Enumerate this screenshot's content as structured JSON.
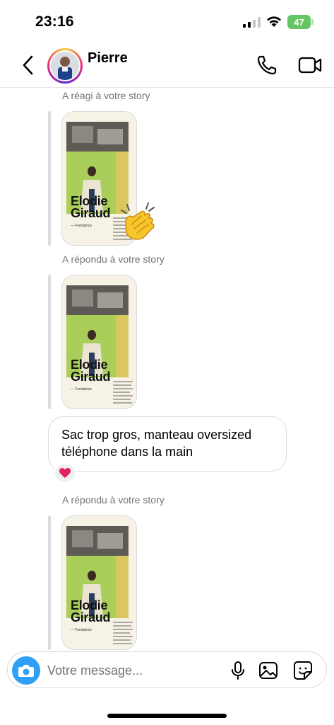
{
  "status_bar": {
    "time": "23:16",
    "battery": "47"
  },
  "header": {
    "contact_name": "Pierre"
  },
  "messages": [
    {
      "type": "story",
      "meta": "A réagi à votre story",
      "story_title_line1": "Elodie",
      "story_title_line2": "Giraud",
      "story_subtitle": "— Fondatrice",
      "reaction_emoji": "👏"
    },
    {
      "type": "story",
      "meta": "A répondu à votre story",
      "story_title_line1": "Elodie",
      "story_title_line2": "Giraud",
      "story_subtitle": "— Fondatrice"
    },
    {
      "type": "text",
      "text_line1": "Sac trop gros, manteau oversized",
      "text_line2": "téléphone dans la main",
      "reaction": "❤️"
    },
    {
      "type": "story",
      "meta": "A répondu à votre story",
      "story_title_line1": "Elodie",
      "story_title_line2": "Giraud",
      "story_subtitle": "— Fondatrice"
    }
  ],
  "composer": {
    "placeholder": "Votre message..."
  },
  "colors": {
    "accent_blue": "#2fa0f5",
    "battery_green": "#65c466",
    "meta_gray": "#737373",
    "border": "#dbdbdb"
  },
  "icons": [
    "back-chevron-icon",
    "phone-icon",
    "video-camera-icon",
    "camera-icon",
    "microphone-icon",
    "gallery-icon",
    "sticker-icon",
    "heart-icon",
    "clap-icon"
  ]
}
